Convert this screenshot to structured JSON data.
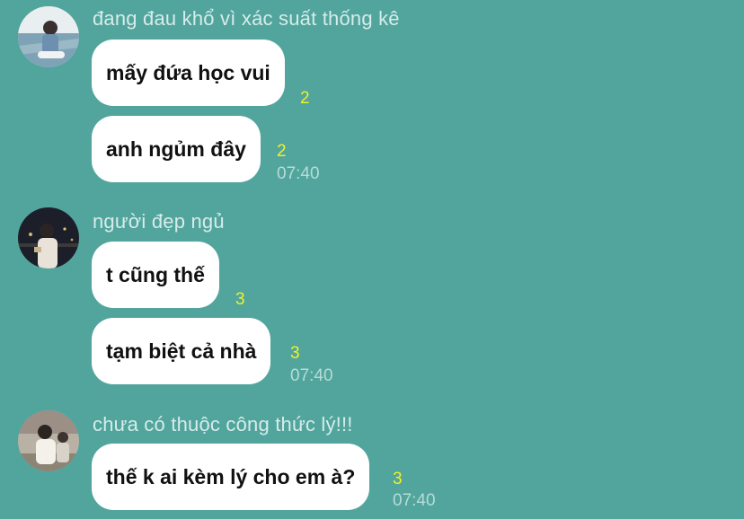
{
  "chat": {
    "groups": [
      {
        "sender": "đang đau khổ vì xác suất thống kê",
        "messages": [
          {
            "text": "mấy đứa học vui",
            "read_count": "2"
          },
          {
            "text": "anh ngủm đây",
            "read_count": "2",
            "time": "07:40"
          }
        ]
      },
      {
        "sender": "người đẹp ngủ",
        "messages": [
          {
            "text": "t cũng thế",
            "read_count": "3"
          },
          {
            "text": "tạm biệt cả nhà",
            "read_count": "3",
            "time": "07:40"
          }
        ]
      },
      {
        "sender": "chưa có thuộc công thức lý!!!",
        "messages": [
          {
            "text": "thế k ai kèm lý cho em à?",
            "read_count": "3",
            "time": "07:40"
          }
        ]
      }
    ]
  },
  "colors": {
    "background": "#51a59d",
    "bubble": "#ffffff",
    "read_count": "#f2ef2a",
    "sender_name": "#d6ecea",
    "timestamp": "#b7dcd8"
  }
}
